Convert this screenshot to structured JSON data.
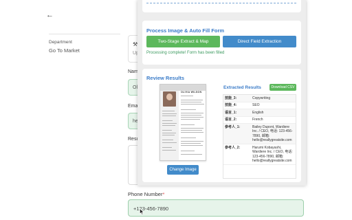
{
  "background_form": {
    "department_label": "Department",
    "department_value": "Go To Market",
    "card_icon": "tools-icon",
    "card_text_fragment": "Up",
    "name_label_fragment": "Nam",
    "name_value_fragment": "Ol",
    "email_label_fragment": "Ema",
    "email_value_fragment": "he",
    "result_label_fragment": "Resu",
    "phone_label": "Phone Number",
    "phone_required_mark": "*",
    "phone_value": "+123-456-7890"
  },
  "modal": {
    "process_title": "Process Image & Auto Fill Form",
    "two_stage_button": "Two-Stage Extract & Map",
    "direct_button": "Direct Field Extraction",
    "status_message": "Processing complete! Form has been filled",
    "review_title": "Review Results",
    "resume_name": "OLIVIA WILSON",
    "change_image_button": "Change Image",
    "extracted_title": "Extracted Results",
    "download_button": "Download CSV",
    "results": [
      {
        "key": "技能_3:",
        "value": "Copywriting"
      },
      {
        "key": "技能_4:",
        "value": "SEO"
      },
      {
        "key": "语言_1:",
        "value": "English"
      },
      {
        "key": "语言_2:",
        "value": "French"
      },
      {
        "key": "参考人_1:",
        "value": "Bailey Dupont, Wardiere Inc. / CEO, 电话: 123-456-7890, 邮箱: hello@reallygreatsite.com"
      },
      {
        "key": "参考人_2:",
        "value": "Harumi Kobayashi, Wardiere Inc. / CEO, 电话: 123-456-7890, 邮箱: hello@reallygreatsite.com"
      }
    ]
  },
  "colors": {
    "accent_blue": "#3a7bc8",
    "button_green": "#5cb85c",
    "button_blue": "#428bca",
    "success_text": "#3c9a5f",
    "filled_input_bg": "#e6f4ea"
  }
}
